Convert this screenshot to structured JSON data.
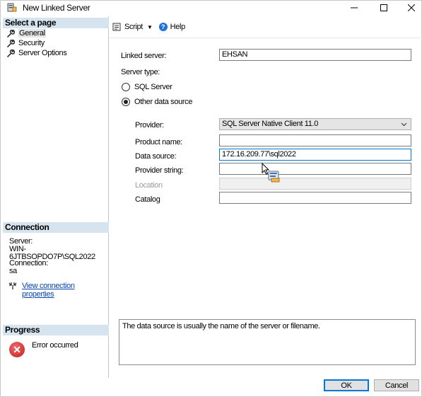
{
  "window": {
    "title": "New Linked Server",
    "controls": {
      "minimize": "—",
      "maximize": "☐",
      "close": "✕"
    }
  },
  "sidebar": {
    "select_page_header": "Select a page",
    "pages": [
      {
        "label": "General",
        "icon": "wrench-icon",
        "selected": true
      },
      {
        "label": "Security",
        "icon": "wrench-icon",
        "selected": false
      },
      {
        "label": "Server Options",
        "icon": "wrench-icon",
        "selected": false
      }
    ],
    "connection": {
      "header": "Connection",
      "server_label": "Server:",
      "server_value": "WIN-6JTBSOPDO7P\\SQL2022",
      "connection_label": "Connection:",
      "connection_value": "sa",
      "view_properties_link": "View connection properties"
    },
    "progress": {
      "header": "Progress",
      "status": "Error occurred",
      "status_icon": "error-icon"
    }
  },
  "toolbar": {
    "script_label": "Script",
    "help_label": "Help"
  },
  "form": {
    "linked_server_label": "Linked server:",
    "linked_server_value": "EHSAN",
    "server_type_label": "Server type:",
    "server_type_options": [
      {
        "label": "SQL Server",
        "checked": false
      },
      {
        "label": "Other data source",
        "checked": true
      }
    ],
    "provider_label": "Provider:",
    "provider_value": "SQL Server Native Client 11.0",
    "product_name_label": "Product name:",
    "product_name_value": "",
    "data_source_label": "Data source:",
    "data_source_value": "172.16.209.77\\sql2022",
    "provider_string_label": "Provider string:",
    "provider_string_value": "",
    "location_label": "Location",
    "location_value": "",
    "catalog_label": "Catalog",
    "catalog_value": ""
  },
  "description": "The data source is usually the name of the server or filename.",
  "buttons": {
    "ok": "OK",
    "cancel": "Cancel"
  },
  "colors": {
    "section_header_bg": "#d6e4ef",
    "link": "#0645ad",
    "focus_border": "#0078d7",
    "error_red": "#c21b1b"
  }
}
